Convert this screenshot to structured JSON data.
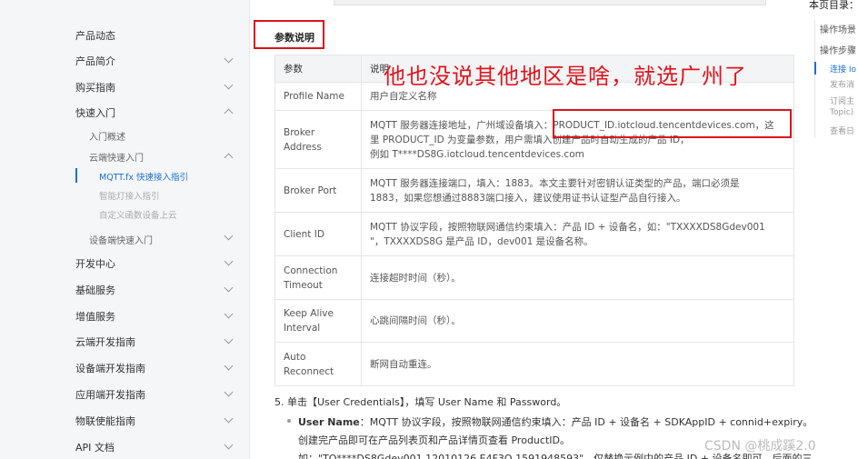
{
  "sidebar": {
    "items": [
      {
        "label": "产品动态"
      },
      {
        "label": "产品简介"
      },
      {
        "label": "购买指南"
      },
      {
        "label": "快速入门"
      },
      {
        "label": "开发中心"
      },
      {
        "label": "基础服务"
      },
      {
        "label": "增值服务"
      },
      {
        "label": "云端开发指南"
      },
      {
        "label": "设备端开发指南"
      },
      {
        "label": "应用端开发指南"
      },
      {
        "label": "物联使能指南"
      },
      {
        "label": "API 文档"
      }
    ],
    "quickstart": {
      "overview": "入门概述",
      "cloud_quickstart": "云端快速入门",
      "cloud_children": [
        "MQTT.fx 快速接入指引",
        "智能灯接入指引",
        "自定义函数设备上云"
      ],
      "device_quickstart": "设备端快速入门"
    }
  },
  "main": {
    "section_title": "参数说明",
    "annotation": "他也没说其他地区是啥，就选广州了",
    "table": {
      "headers": [
        "参数",
        "说明"
      ],
      "rows": [
        {
          "name": "Profile Name",
          "desc": "用户自定义名称"
        },
        {
          "name": "Broker\nAddress",
          "desc": "MQTT 服务器连接地址，广州域设备填入：PRODUCT_ID.iotcloud.tencentdevices.com，这\n里 PRODUCT_ID 为变量参数，用户需填入创建产品时自动生成的产品 ID，\n例如 T****DS8G.iotcloud.tencentdevices.com"
        },
        {
          "name": "Broker Port",
          "desc": "MQTT 服务器连接端口，填入：1883。本文主要针对密钥认证类型的产品，端口必须是\n1883，如果您想通过8883端口接入，建议使用证书认证型产品自行接入。"
        },
        {
          "name": "Client ID",
          "desc": "MQTT 协议字段，按照物联网通信约束填入：产品 ID + 设备名，如：\"TXXXXDS8Gdev001\n\"，TXXXXDS8G 是产品 ID，dev001 是设备名称。"
        },
        {
          "name": "Connection\nTimeout",
          "desc": "连接超时时间（秒）。"
        },
        {
          "name": "Keep Alive\nInterval",
          "desc": "心跳间隔时间（秒）。"
        },
        {
          "name": "Auto\nReconnect",
          "desc": "断网自动重连。"
        }
      ]
    },
    "step5": "5. 单击【User Credentials】，填写 User Name 和 Password。",
    "user_name_label": "User Name",
    "user_name_text": "：MQTT 协议字段，按照物联网通信约束填入：产品 ID + 设备名 + SDKAppID + connid+expiry。",
    "line2": "创建完产品即可在产品列表页和产品详情页查看 ProductID。",
    "line3": "如：\"TO****DS8Gdev001 12010126 E4F3O 1591948593\"，仅替换示例中的产品 ID + 设备名即可，后面的三"
  },
  "toc": {
    "title": "本页目录：",
    "items": [
      "操作场景",
      "操作步骤"
    ],
    "subs": [
      "连接 Io",
      "发布消",
      "订阅主",
      "Topic)",
      "查看日"
    ]
  },
  "watermark": "CSDN @桃成蹊2.0",
  "colors": {
    "accent": "#1a6fd8",
    "annotation": "#e0141c"
  }
}
